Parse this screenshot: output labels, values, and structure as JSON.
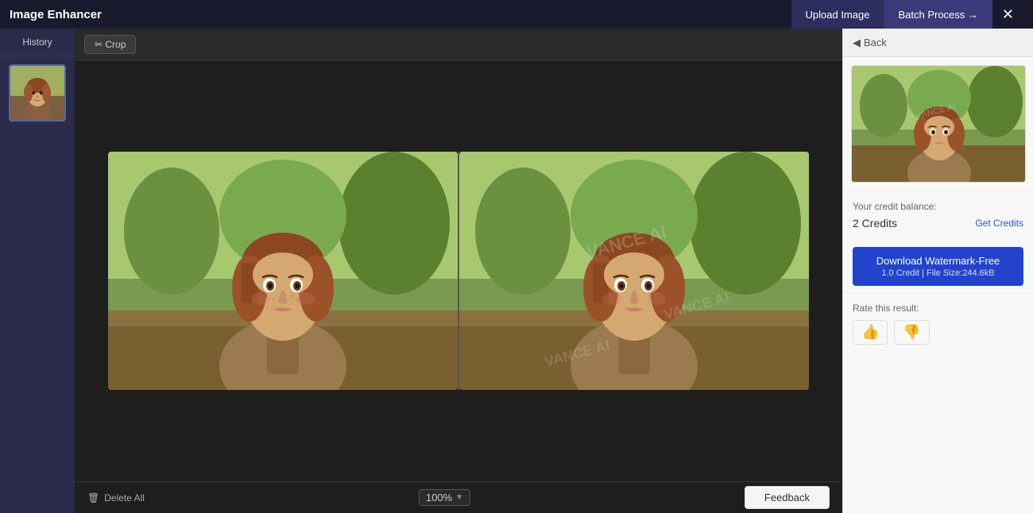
{
  "app": {
    "title": "Image Enhancer"
  },
  "header": {
    "upload_label": "Upload Image",
    "batch_label": "Batch Process →",
    "close_label": "✕"
  },
  "sidebar": {
    "history_tab": "History"
  },
  "toolbar": {
    "crop_label": "✂ Crop"
  },
  "canvas": {
    "zoom_value": "100%",
    "watermark_text": "VANCE AI"
  },
  "bottom_bar": {
    "delete_all_label": "Delete All",
    "feedback_label": "Feedback"
  },
  "right_panel": {
    "back_label": "Back",
    "credit_balance_label": "Your credit balance:",
    "credit_count": "2 Credits",
    "get_credits_label": "Get Credits",
    "download_label": "Download Watermark-Free",
    "download_sub": "1.0 Credit | File Size:244.6kB",
    "rate_label": "Rate this result:"
  }
}
